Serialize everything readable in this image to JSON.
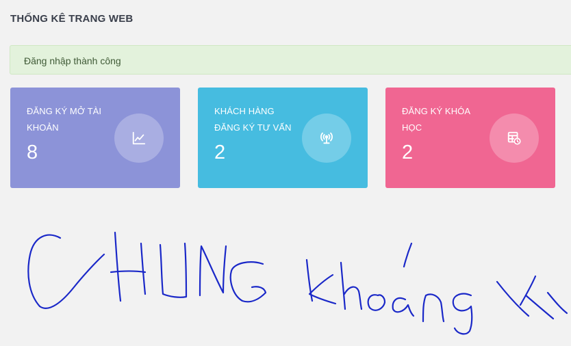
{
  "header": {
    "title": "THỐNG KÊ TRANG WEB"
  },
  "alert": {
    "message": "Đăng nhập thành công"
  },
  "cards": [
    {
      "title": "ĐĂNG KÝ MỞ TÀI KHOẢN",
      "value": "8",
      "color": "#8c93d8",
      "icon": "line-chart-icon"
    },
    {
      "title": "KHÁCH HÀNG ĐĂNG KÝ TƯ VẤN",
      "value": "2",
      "color": "#46bce0",
      "icon": "broadcast-icon"
    },
    {
      "title": "ĐĂNG KÝ KHÓA HỌC",
      "value": "2",
      "color": "#f06692",
      "icon": "table-clock-icon"
    }
  ],
  "annotation": {
    "text": "CHUNG khoáng vk",
    "color": "#1a28c8"
  }
}
